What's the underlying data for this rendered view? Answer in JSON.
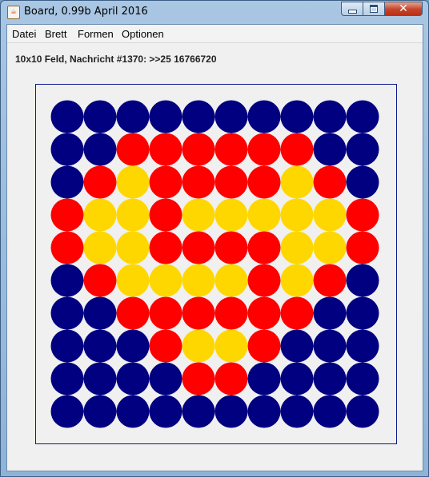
{
  "window": {
    "title": "Board, 0.99b April 2016",
    "app_icon_name": "java-icon",
    "controls": [
      "minimize",
      "maximize",
      "close"
    ]
  },
  "menu": {
    "items": [
      "Datei",
      "Brett",
      "Formen",
      "Optionen"
    ]
  },
  "status": {
    "text": "10x10 Feld, Nachricht #1370: >>25 16766720"
  },
  "board": {
    "rows": 10,
    "cols": 10,
    "colors": {
      "B": "#000080",
      "R": "#ff0000",
      "Y": "#ffd700"
    },
    "grid": [
      "BBBBBBBBBB",
      "BBRRRRRRBB",
      "BRYRRRRYRB",
      "RYYRYYYYYR",
      "RYYRRRRYYR",
      "BRYYYYRYRB",
      "BBRRRRRRBB",
      "BBBRYYRBBB",
      "BBBBRRBBBB",
      "BBBBBBBBBB"
    ]
  }
}
